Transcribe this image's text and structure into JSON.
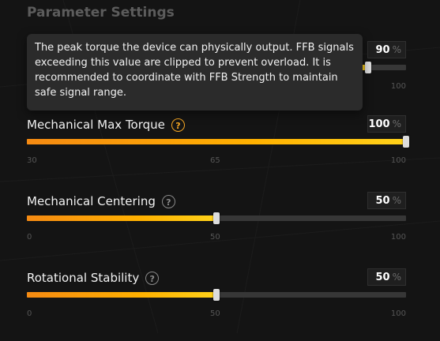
{
  "section_title": "Parameter Settings",
  "tooltip": {
    "text": "The peak torque the device can physically output. FFB signals exceeding this value are clipped to prevent overload. It is recommended to coordinate with FFB Strength to maintain safe signal range."
  },
  "params": [
    {
      "label": "",
      "value": "90",
      "unit": "%",
      "min": "",
      "mid": "",
      "max": "100",
      "fill": 0.9
    },
    {
      "label": "Mechanical Max Torque",
      "value": "100",
      "unit": "%",
      "min": "30",
      "mid": "65",
      "max": "100",
      "fill": 1.0,
      "help_active": true
    },
    {
      "label": "Mechanical Centering",
      "value": "50",
      "unit": "%",
      "min": "0",
      "mid": "50",
      "max": "100",
      "fill": 0.5
    },
    {
      "label": "Rotational Stability",
      "value": "50",
      "unit": "%",
      "min": "0",
      "mid": "50",
      "max": "100",
      "fill": 0.5
    }
  ],
  "help_symbol": "?",
  "colors": {
    "accent": "#f5a623",
    "track": "#373737",
    "background": "#141414"
  }
}
